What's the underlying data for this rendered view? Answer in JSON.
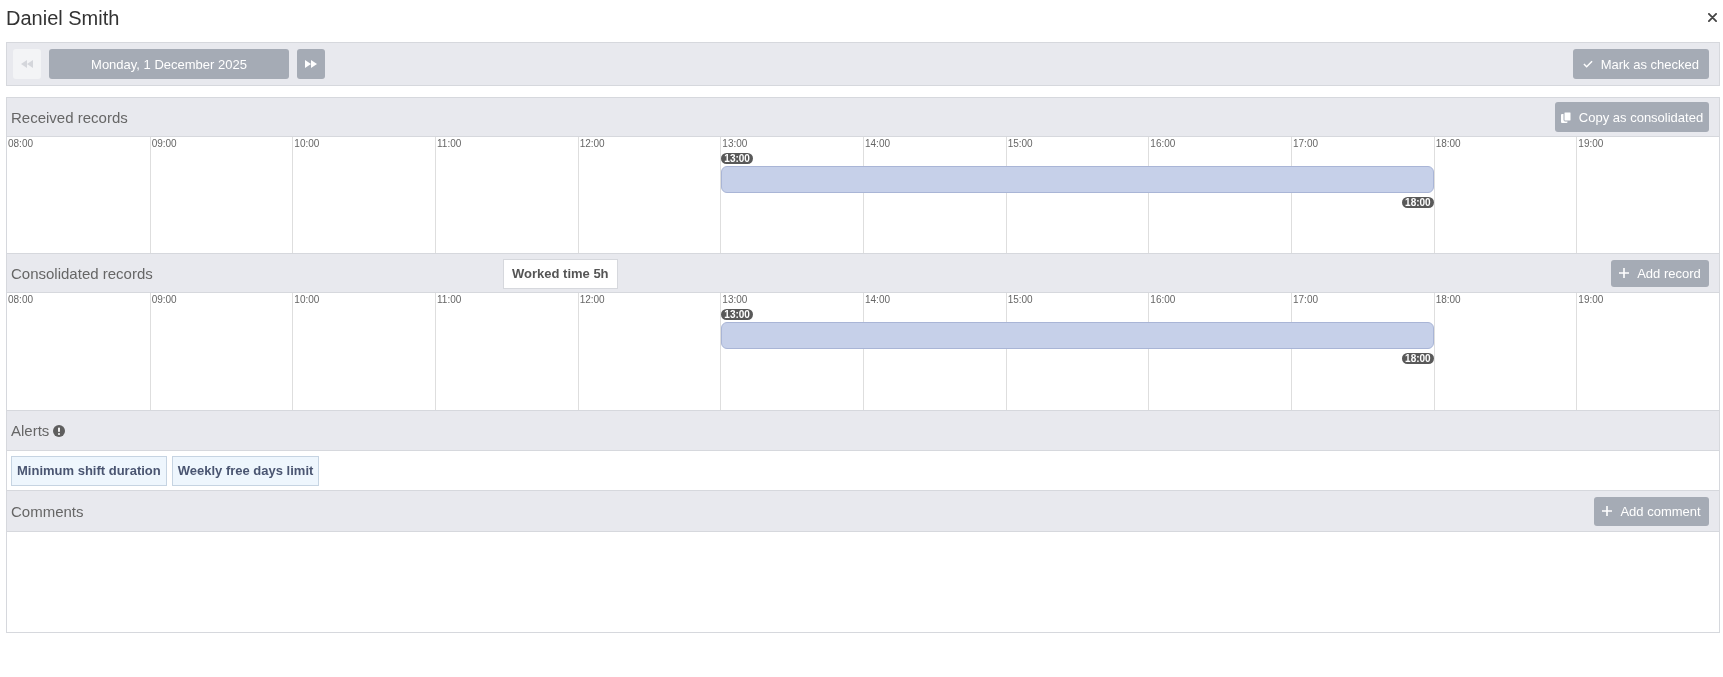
{
  "window": {
    "title": "Daniel Smith"
  },
  "toolbar": {
    "previous_button": {
      "disabled": true
    },
    "date_button": "Monday, 1 December 2025",
    "next_button": {
      "disabled": false
    },
    "action_button": "Mark as checked"
  },
  "received_records": {
    "title": "Received records",
    "button": "Copy as consolidated",
    "hours": [
      "08:00",
      "09:00",
      "10:00",
      "11:00",
      "12:00",
      "13:00",
      "14:00",
      "15:00",
      "16:00",
      "17:00",
      "18:00",
      "19:00"
    ],
    "records": [
      {
        "start": "13:00",
        "end": "18:00"
      }
    ]
  },
  "consolidated_records": {
    "title": "Consolidated records",
    "tooltip": "Worked time 5h",
    "button": "Add record",
    "hours": [
      "08:00",
      "09:00",
      "10:00",
      "11:00",
      "12:00",
      "13:00",
      "14:00",
      "15:00",
      "16:00",
      "17:00",
      "18:00",
      "19:00"
    ],
    "records": [
      {
        "start": "13:00",
        "end": "18:00"
      }
    ]
  },
  "alerts": {
    "title": "Alerts",
    "items": [
      "Minimum shift duration",
      "Weekly free days limit"
    ]
  },
  "comments": {
    "title": "Comments",
    "button": "Add comment"
  }
}
